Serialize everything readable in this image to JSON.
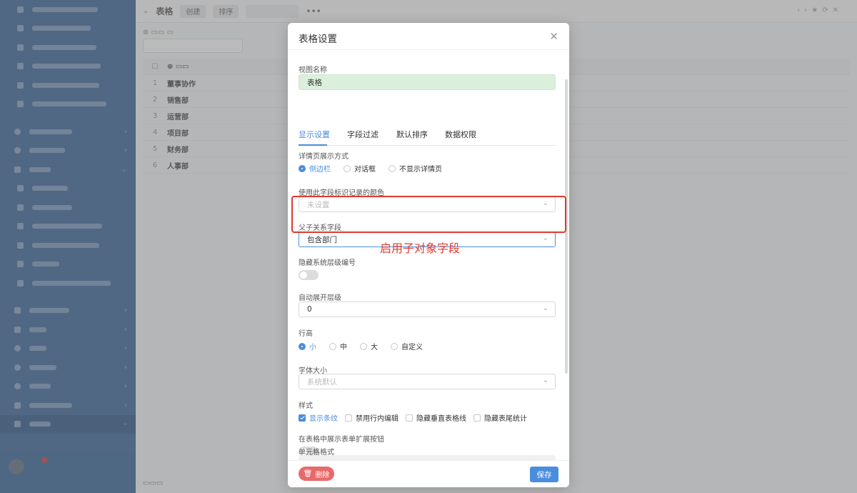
{
  "background": {
    "topbar": {
      "title": "表格",
      "buttons": [
        "创建",
        "排序"
      ]
    },
    "table_rows": [
      {
        "n": "1",
        "name": "董事协作"
      },
      {
        "n": "2",
        "name": "销售部"
      },
      {
        "n": "3",
        "name": "运营部"
      },
      {
        "n": "4",
        "name": "项目部"
      },
      {
        "n": "5",
        "name": "财务部"
      },
      {
        "n": "6",
        "name": "人事部"
      }
    ]
  },
  "modal": {
    "title": "表格设置",
    "view_name": {
      "label": "视图名称",
      "value": "表格"
    },
    "tabs": [
      "显示设置",
      "字段过滤",
      "默认排序",
      "数据权限"
    ],
    "detail_display": {
      "label": "详情页展示方式",
      "options": [
        "侧边栏",
        "对话框",
        "不显示详情页"
      ],
      "selected": "侧边栏"
    },
    "color_field": {
      "label": "使用此字段标识记录的颜色",
      "placeholder": "未设置"
    },
    "parent_child": {
      "label": "父子关系字段",
      "value": "包含部门"
    },
    "hide_level_no": {
      "label": "隐藏系统层级编号"
    },
    "auto_expand": {
      "label": "自动展开层级",
      "value": "0"
    },
    "row_height": {
      "label": "行高",
      "options": [
        "小",
        "中",
        "大",
        "自定义"
      ],
      "selected": "小"
    },
    "font_size": {
      "label": "字体大小",
      "placeholder": "系统默认"
    },
    "style": {
      "label": "样式",
      "options": [
        "显示条纹",
        "禁用行内编辑",
        "隐藏垂直表格线",
        "隐藏表尾统计"
      ],
      "checked": [
        "显示条纹"
      ]
    },
    "show_expand_btn": {
      "label": "在表格中展示表单扩展按钮"
    },
    "cell_format": {
      "label": "单元格格式"
    },
    "footer": {
      "delete": "删除",
      "save": "保存"
    }
  },
  "annotation": {
    "text": "启用子对象字段",
    "color": "#e03a2e"
  },
  "colors": {
    "accent": "#4a8ddc",
    "danger": "#e86a6a",
    "sidebar": "#4b73a3"
  }
}
